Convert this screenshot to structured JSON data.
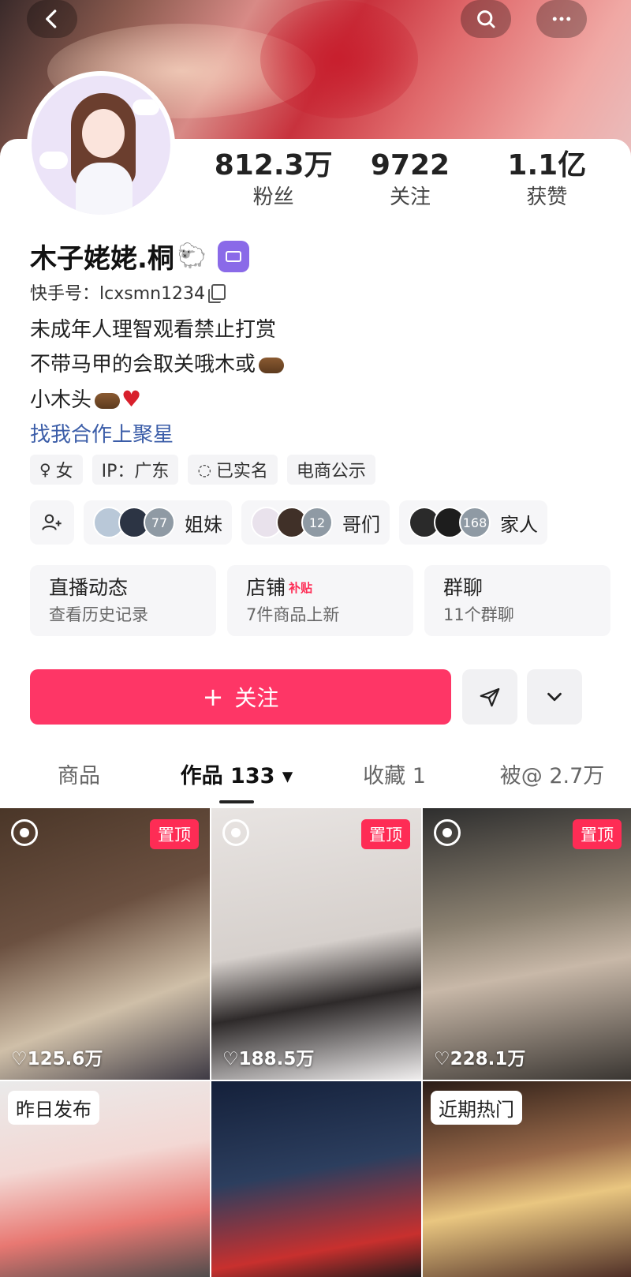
{
  "header": {
    "back_icon": "chevron-left-icon",
    "search_icon": "search-icon",
    "more_icon": "more-icon"
  },
  "profile": {
    "name": "木子姥姥.桐",
    "name_emoji": "🐑",
    "kuaishou_id": "快手号：lcxsmn1234",
    "bio_lines": [
      "未成年人理智观看禁止打赏",
      "不带马甲的会取关哦木或",
      "小木头"
    ],
    "bio_heart": "♥",
    "bio_link": "找我合作上聚星"
  },
  "stats": [
    {
      "value": "812.3万",
      "label": "粉丝"
    },
    {
      "value": "9722",
      "label": "关注"
    },
    {
      "value": "1.1亿",
      "label": "获赞"
    }
  ],
  "tags": [
    {
      "icon": "female-icon",
      "glyph": "♀",
      "label": "女"
    },
    {
      "icon": "",
      "glyph": "",
      "label": "IP：广东"
    },
    {
      "icon": "verified-shield-icon",
      "glyph": "◌",
      "label": "已实名"
    },
    {
      "icon": "",
      "glyph": "",
      "label": "电商公示"
    }
  ],
  "groups": [
    {
      "count": "77",
      "label": "姐妹"
    },
    {
      "count": "12",
      "label": "哥们"
    },
    {
      "count": "168",
      "label": "家人"
    }
  ],
  "cards": [
    {
      "title": "直播动态",
      "subtitle": "查看历史记录",
      "badge": ""
    },
    {
      "title": "店铺",
      "subtitle": "7件商品上新",
      "badge": "补贴"
    },
    {
      "title": "群聊",
      "subtitle": "11个群聊",
      "badge": ""
    }
  ],
  "actions": {
    "follow_label": "关注",
    "follow_plus": "+",
    "brand_color": "#fe3666"
  },
  "tabs": [
    {
      "label": "商品"
    },
    {
      "label": "作品 133 ▾"
    },
    {
      "label": "收藏 1"
    },
    {
      "label": "被@ 2.7万"
    }
  ],
  "videos": [
    {
      "pinned": "置顶",
      "likes": "♡125.6万"
    },
    {
      "pinned": "置顶",
      "likes": "♡188.5万"
    },
    {
      "pinned": "置顶",
      "likes": "♡228.1万"
    },
    {
      "corner": "昨日发布"
    },
    {
      "corner": ""
    },
    {
      "corner": "近期热门"
    }
  ]
}
